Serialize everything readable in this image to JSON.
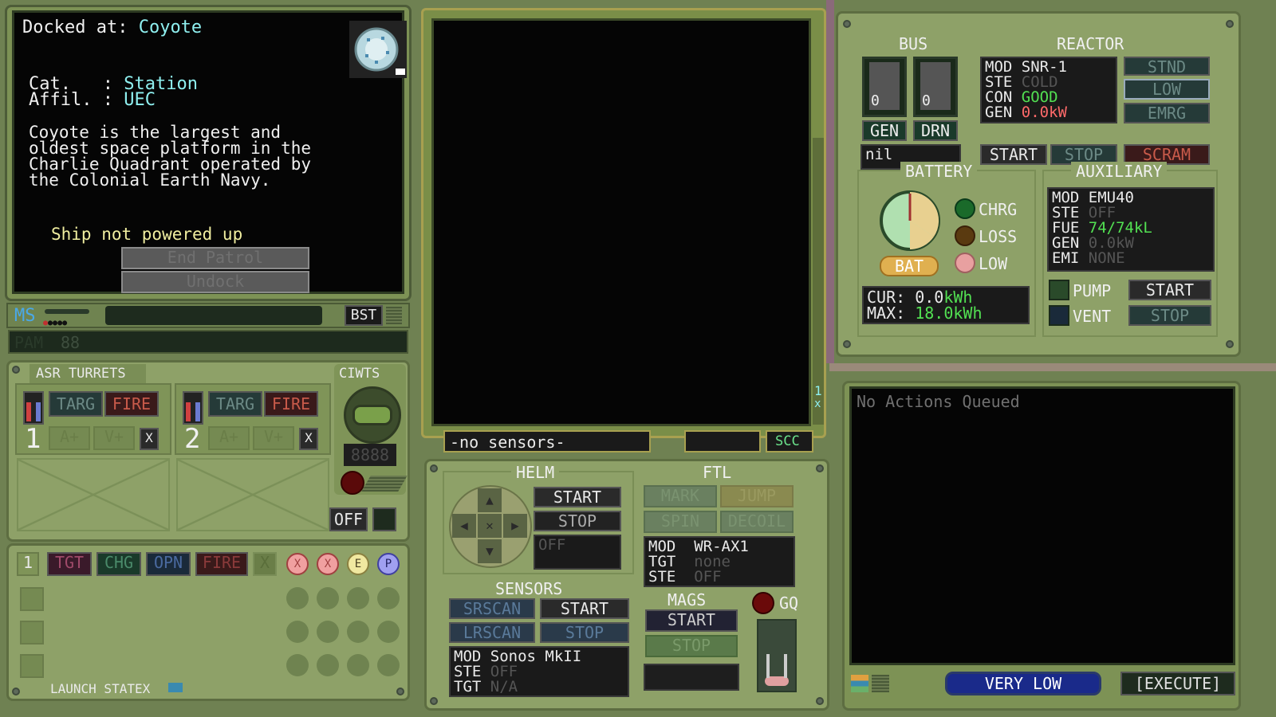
{
  "dock": {
    "docked_label": "Docked at:",
    "station_name": "Coyote",
    "cat_label": "Cat.   :",
    "cat_value": "Station",
    "affil_label": "Affil. :",
    "affil_value": "UEC",
    "description": [
      "Coyote is the largest and",
      "oldest space platform in the",
      "Charlie Quadrant operated by",
      "the Colonial Earth Navy."
    ],
    "status": "Ship not powered up",
    "end_patrol": "End Patrol",
    "undock": "Undock"
  },
  "status_bar": {
    "ms_label": "MS",
    "bst_label": "BST",
    "pam_label": "PAM",
    "pam_value": "88"
  },
  "turrets": {
    "title": "ASR TURRETS",
    "units": [
      {
        "number": "1",
        "targ": "TARG",
        "fire": "FIRE",
        "a_plus": "A+",
        "v_plus": "V+",
        "x": "X"
      },
      {
        "number": "2",
        "targ": "TARG",
        "fire": "FIRE",
        "a_plus": "A+",
        "v_plus": "V+",
        "x": "X"
      }
    ]
  },
  "ciwts": {
    "title": "CIWTS",
    "counter": "8888",
    "off": "OFF"
  },
  "launch": {
    "slot": "1",
    "tgt": "TGT",
    "chg": "CHG",
    "opn": "OPN",
    "fire": "FIRE",
    "x": "X",
    "circles": [
      "X",
      "X",
      "E",
      "P"
    ],
    "footer": "LAUNCH STATEX"
  },
  "sensor_view": {
    "status": "-no sensors-",
    "scc": "SCC",
    "side_digit": "1",
    "side_x": "x"
  },
  "helm": {
    "title": "HELM",
    "start": "START",
    "stop": "STOP",
    "state": "OFF"
  },
  "ftl": {
    "title": "FTL",
    "mark": "MARK",
    "jump": "JUMP",
    "spin": "SPIN",
    "decoil": "DECOIL",
    "readout": [
      [
        "MOD",
        "WR-AX1"
      ],
      [
        "TGT",
        "none"
      ],
      [
        "STE",
        "OFF"
      ]
    ]
  },
  "sensors": {
    "title": "SENSORS",
    "srscan": "SRSCAN",
    "lrscan": "LRSCAN",
    "start": "START",
    "stop": "STOP",
    "readout": [
      [
        "MOD",
        "Sonos MkII"
      ],
      [
        "STE",
        "OFF"
      ],
      [
        "TGT",
        "N/A"
      ]
    ]
  },
  "mags": {
    "title": "MAGS",
    "start": "START",
    "stop": "STOP"
  },
  "gq": {
    "label": "GQ"
  },
  "bus": {
    "title": "BUS",
    "gen_value": "0",
    "drn_value": "0",
    "gen_label": "GEN",
    "drn_label": "DRN",
    "readout": "nil"
  },
  "reactor": {
    "title": "REACTOR",
    "readout": [
      [
        "MOD",
        "SNR-1"
      ],
      [
        "STE",
        "COLD"
      ],
      [
        "CON",
        "GOOD"
      ],
      [
        "GEN",
        "0.0kW"
      ]
    ],
    "stnd": "STND",
    "low": "LOW",
    "emrg": "EMRG",
    "start": "START",
    "stop": "STOP",
    "scram": "SCRAM"
  },
  "battery": {
    "title": "BATTERY",
    "bat": "BAT",
    "chrg": "CHRG",
    "loss": "LOSS",
    "low": "LOW",
    "cur_label": "CUR:",
    "cur_value": "0.0",
    "max_label": "MAX:",
    "max_value": "18.0",
    "unit": "kWh"
  },
  "auxiliary": {
    "title": "AUXILIARY",
    "readout": [
      [
        "MOD",
        "EMU40"
      ],
      [
        "STE",
        "OFF"
      ],
      [
        "FUE",
        "74/74kL"
      ],
      [
        "GEN",
        "0.0kW"
      ],
      [
        "EMI",
        "NONE"
      ]
    ],
    "pump": "PUMP",
    "vent": "VENT",
    "start": "START",
    "stop": "STOP"
  },
  "actions": {
    "queue": "No Actions Queued",
    "priority": "VERY LOW",
    "execute": "[EXECUTE]"
  }
}
